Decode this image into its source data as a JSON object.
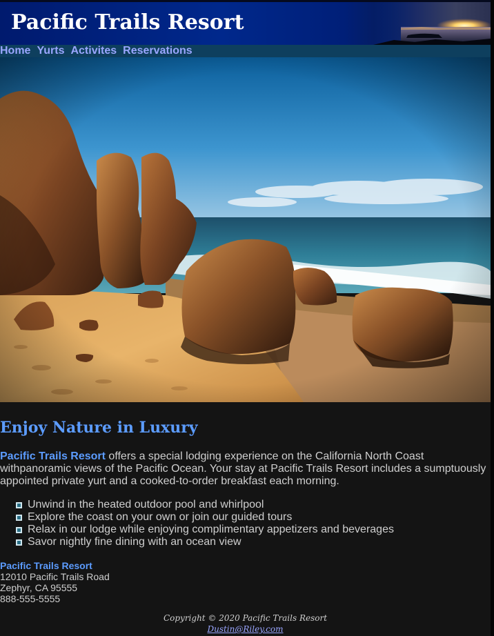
{
  "header": {
    "title": "Pacific Trails Resort"
  },
  "nav": {
    "items": [
      "Home",
      "Yurts",
      "Activites",
      "Reservations"
    ]
  },
  "main": {
    "heading": "Enjoy Nature in Luxury",
    "intro_brand": "Pacific Trails Resort",
    "intro_text": " offers a special lodging experience on the California North Coast withpanoramic views of the Pacific Ocean. Your stay at Pacific Trails Resort includes a sumptuously appointed private yurt and a cooked-to-order breakfast each morning.",
    "features": [
      "Unwind in the heated outdoor pool and whirlpool",
      "Explore the coast on your own or join our guided tours",
      "Relax in our lodge while enjoying complimentary appetizers and beverages",
      "Savor nightly fine dining with an ocean view"
    ]
  },
  "address": {
    "name": "Pacific Trails Resort",
    "street": "12010 Pacific Trails Road",
    "city": "Zephyr, CA 95555",
    "phone": "888-555-5555"
  },
  "footer": {
    "copyright": "Copyright © 2020 Pacific Trails Resort",
    "email": "Dustin@Riley.com"
  },
  "colors": {
    "page_background": "#141414",
    "header_blue": "#00288c",
    "nav_background": "#0e3f5e",
    "nav_link": "#9aa6ff",
    "accent_blue": "#5c9cff",
    "body_text": "#cfcfcf"
  },
  "icons": {
    "list_bullet": "square-bullet-icon"
  }
}
